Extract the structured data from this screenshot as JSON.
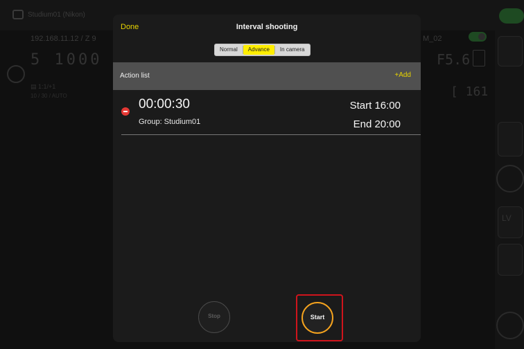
{
  "background": {
    "camera_name": "Studium01 (Nikon)",
    "ip": "192.168.11.12 / Z 9",
    "shutter_display": "5  1000",
    "left_text_1": "▤ 1:1/+1",
    "left_text_2": "10 / 30 / AUTO",
    "right_label": "M_02",
    "aperture_display": "F5.6",
    "count_display": "[ 161 ]",
    "lv_label": "LV"
  },
  "modal": {
    "done_label": "Done",
    "title": "Interval shooting",
    "segments": [
      {
        "label": "Normal",
        "active": false
      },
      {
        "label": "Advance",
        "active": true
      },
      {
        "label": "In camera",
        "active": false
      }
    ],
    "action_list_title": "Action list",
    "add_label": "+Add",
    "items": [
      {
        "duration": "00:00:30",
        "group": "Group: Studium01",
        "start": "Start 16:00",
        "end": "End 20:00"
      }
    ],
    "stop_label": "Stop",
    "start_label": "Start"
  },
  "colors": {
    "accent_yellow": "#e8d400",
    "start_ring": "#f5a31e",
    "highlight_red": "#d0141c",
    "remove_red": "#e53935"
  }
}
